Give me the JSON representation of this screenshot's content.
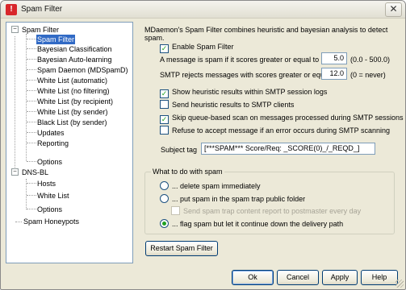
{
  "window": {
    "title": "Spam Filter"
  },
  "tree": {
    "items": [
      {
        "label": "Spam Filter",
        "level": 0
      },
      {
        "label": "Spam Filter",
        "level": 1,
        "selected": true
      },
      {
        "label": "Bayesian Classification",
        "level": 1
      },
      {
        "label": "Bayesian Auto-learning",
        "level": 1
      },
      {
        "label": "Spam Daemon (MDSpamD)",
        "level": 1
      },
      {
        "label": "White List (automatic)",
        "level": 1
      },
      {
        "label": "White List (no filtering)",
        "level": 1
      },
      {
        "label": "White List (by recipient)",
        "level": 1
      },
      {
        "label": "White List (by sender)",
        "level": 1
      },
      {
        "label": "Black List (by sender)",
        "level": 1
      },
      {
        "label": "Updates",
        "level": 1
      },
      {
        "label": "Reporting",
        "level": 1
      },
      {
        "label": "Options",
        "level": 1
      },
      {
        "label": "DNS-BL",
        "level": 0
      },
      {
        "label": "Hosts",
        "level": 1
      },
      {
        "label": "White List",
        "level": 1
      },
      {
        "label": "Options",
        "level": 1
      },
      {
        "label": "Spam Honeypots",
        "level": 0
      }
    ]
  },
  "main": {
    "intro": "MDaemon's Spam Filter combines heuristic and bayesian analysis to detect spam.",
    "enable_spam_filter": "Enable Spam Filter",
    "score_label": "A message is spam if it scores greater or equal to",
    "score_value": "5.0",
    "score_range": "(0.0 - 500.0)",
    "reject_label": "SMTP rejects messages with scores greater or equal to",
    "reject_value": "12.0",
    "reject_hint": "(0 = never)",
    "show_heuristic": "Show heuristic results within SMTP session logs",
    "send_heuristic": "Send heuristic results to SMTP clients",
    "skip_queue": "Skip queue-based scan on messages processed during SMTP sessions",
    "refuse_error": "Refuse to accept message if an error occurs during SMTP scanning",
    "subject_tag_label": "Subject tag",
    "subject_tag_value": "[***SPAM*** Score/Req: _SCORE(0)_/_REQD_]"
  },
  "what_to_do": {
    "label": "What to do with spam",
    "delete": "... delete spam immediately",
    "trap": "... put spam in the spam trap public folder",
    "trap_report": "Send spam trap content report to postmaster every day",
    "flag": "... flag spam but let it continue down the delivery path"
  },
  "buttons": {
    "restart": "Restart Spam Filter",
    "ok": "Ok",
    "cancel": "Cancel",
    "apply": "Apply",
    "help": "Help"
  },
  "colors": {
    "selection": "#316ac5",
    "check": "#21a121",
    "dialog_bg": "#ece9d8"
  }
}
